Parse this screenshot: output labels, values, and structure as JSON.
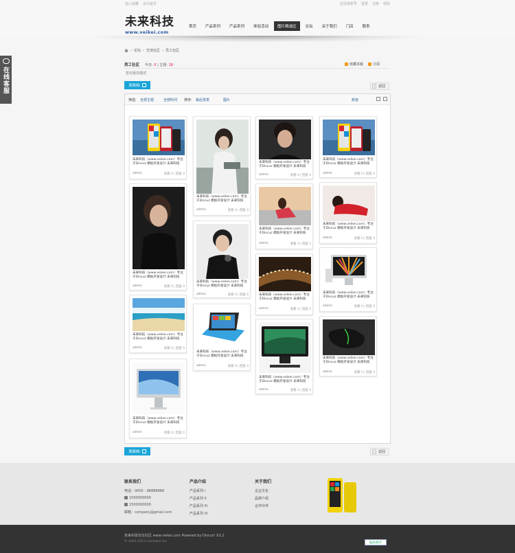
{
  "topbar": {
    "left": [
      "加入收藏",
      "设为首页"
    ],
    "right": [
      "还没有账号",
      "登录",
      "注册",
      "帮助"
    ]
  },
  "logo": {
    "cn": "未来科技",
    "en": "www.veikei.com"
  },
  "nav": [
    "首页",
    "产品系列",
    "产品系列",
    "体验活动",
    "图片精选区",
    "论坛",
    "关于我们",
    "门店",
    "联系"
  ],
  "sidetab": {
    "label": "在线客服"
  },
  "breadcrumb": [
    "论坛",
    "交流社区",
    "员工社区"
  ],
  "forum": {
    "title": "员工社区",
    "stats_prefix": "今日:",
    "today": "0",
    "stats_mid": "| 主题:",
    "topics": "18",
    "fav": "收藏本版",
    "rss": "订阅",
    "desc": "暂无版块描述"
  },
  "buttons": {
    "post": "发新帖",
    "back": "返回"
  },
  "filter": {
    "a": "筛选:",
    "b": "全部主题",
    "c": "全部时间",
    "d": "排序:",
    "e": "最后发表",
    "f": "图片",
    "g": "新窗"
  },
  "cards": [
    {
      "cap": "未来科技（www.veikei.com）专注于Discuz 模板开发设计 未来科技",
      "author": "admin",
      "stat": "查看 0 | 回复 0"
    },
    {
      "cap": "未来科技（www.veikei.com）专注于Discuz 模板开发设计 未来科技",
      "author": "admin",
      "stat": "查看 0 | 回复 0"
    },
    {
      "cap": "未来科技（www.veikei.com）专注于Discuz 模板开发设计 未来科技",
      "author": "admin",
      "stat": "查看 0 | 回复 0"
    },
    {
      "cap": "未来科技（www.veikei.com）专注于Discuz 模板开发设计 未来科技",
      "author": "admin",
      "stat": "查看 0 | 回复 0"
    },
    {
      "cap": "未来科技（www.veikei.com）专注于Discuz 模板开发设计 未来科技",
      "author": "admin",
      "stat": "查看 0 | 回复 0"
    },
    {
      "cap": "未来科技（www.veikei.com）专注于Discuz 模板开发设计 未来科技",
      "author": "admin",
      "stat": "查看 0 | 回复 0"
    },
    {
      "cap": "未来科技（www.veikei.com）专注于Discuz 模板开发设计 未来科技",
      "author": "admin",
      "stat": "查看 0 | 回复 0"
    },
    {
      "cap": "未来科技（www.veikei.com）专注于Discuz 模板开发设计 未来科技",
      "author": "admin",
      "stat": "查看 0 | 回复 0"
    },
    {
      "cap": "未来科技（www.veikei.com）专注于Discuz 模板开发设计 未来科技",
      "author": "admin",
      "stat": "查看 0 | 回复 0"
    },
    {
      "cap": "未来科技（www.veikei.com）专注于Discuz 模板开发设计 未来科技",
      "author": "admin",
      "stat": "查看 0 | 回复 0"
    },
    {
      "cap": "未来科技（www.veikei.com）专注于Discuz 模板开发设计 未来科技",
      "author": "admin",
      "stat": "查看 0 | 回复 0"
    },
    {
      "cap": "未来科技（www.veikei.com）专注于Discuz 模板开发设计 未来科技",
      "author": "admin",
      "stat": "查看 0 | 回复 0"
    },
    {
      "cap": "未来科技（www.veikei.com）专注于Discuz 模板开发设计 未来科技",
      "author": "admin",
      "stat": "查看 0 | 回复 0"
    },
    {
      "cap": "未来科技（www.veikei.com）专注于Discuz 模板开发设计 未来科技",
      "author": "admin",
      "stat": "查看 0 | 回复 0"
    },
    {
      "cap": "未来科技（www.veikei.com）专注于Discuz 模板开发设计 未来科技",
      "author": "admin",
      "stat": "查看 0 | 回复 0"
    }
  ],
  "footer": {
    "contact": {
      "title": "联系我们",
      "lines": [
        "电话：0000 - 88888888",
        "1500000000",
        "1500000000",
        "邮箱：company@gmail.com"
      ]
    },
    "products": {
      "title": "产品介绍",
      "lines": [
        "产品系列 I",
        "产品系列 II",
        "产品系列 III",
        "产品系列 IV"
      ]
    },
    "about": {
      "title": "关于我们",
      "lines": [
        "企业文化",
        "品牌介绍",
        "合作伙伴"
      ]
    }
  },
  "copyright": {
    "line1": "未来科技论坛社区 www.veikei.com  Powered by Discuz! X3.2",
    "line2": "© 2001-2013 Comsenz Inc.",
    "badge": "站长统计"
  }
}
